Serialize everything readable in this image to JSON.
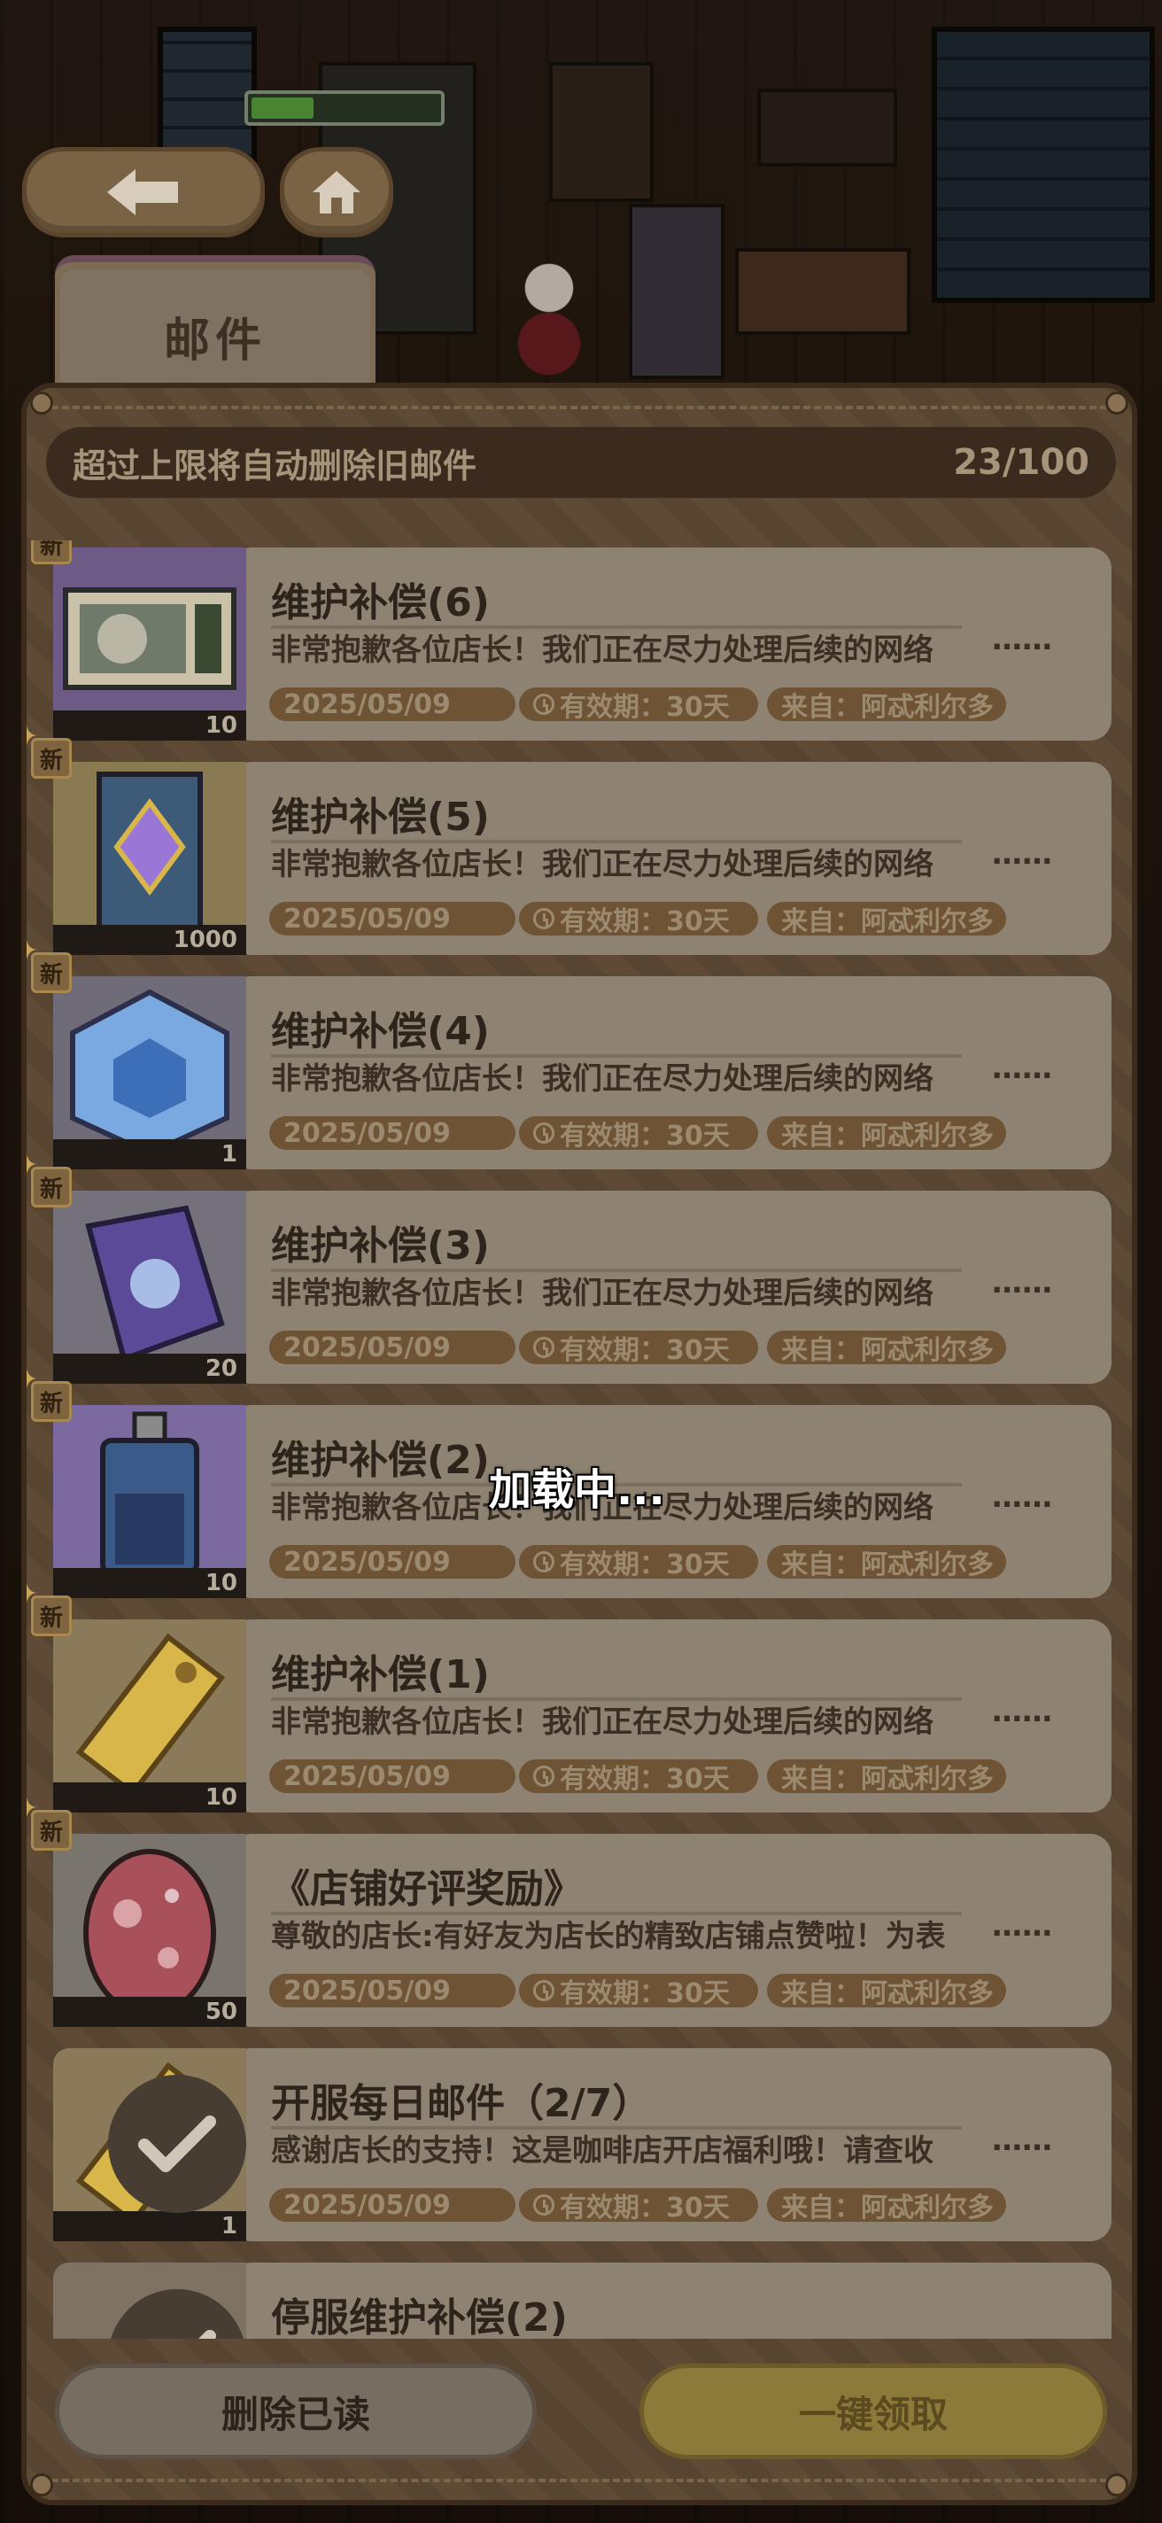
{
  "nav": {
    "back_icon": "arrow-left-icon",
    "home_icon": "home-icon"
  },
  "tab": {
    "label": "邮件"
  },
  "info": {
    "text": "超过上限将自动删除旧邮件",
    "count": "23/100"
  },
  "mail": [
    {
      "title": "维护补偿(6)",
      "body": "非常抱歉各位店长！我们正在尽力处理后续的网络",
      "ellipsis": "……",
      "date": "2025/05/09",
      "validity": "有效期：30天",
      "from": "来自：阿忒利尔多",
      "qty": "10",
      "is_new": true,
      "item_icon": "microwave-icon",
      "read": false
    },
    {
      "title": "维护补偿(5)",
      "body": "非常抱歉各位店长！我们正在尽力处理后续的网络",
      "ellipsis": "……",
      "date": "2025/05/09",
      "validity": "有效期：30天",
      "from": "来自：阿忒利尔多",
      "qty": "1000",
      "is_new": true,
      "item_icon": "purple-gem-card-icon",
      "read": false
    },
    {
      "title": "维护补偿(4)",
      "body": "非常抱歉各位店长！我们正在尽力处理后续的网络",
      "ellipsis": "……",
      "date": "2025/05/09",
      "validity": "有效期：30天",
      "from": "来自：阿忒利尔多",
      "qty": "1",
      "is_new": true,
      "item_icon": "blue-crystal-icon",
      "read": false
    },
    {
      "title": "维护补偿(3)",
      "body": "非常抱歉各位店长！我们正在尽力处理后续的网络",
      "ellipsis": "……",
      "date": "2025/05/09",
      "validity": "有效期：30天",
      "from": "来自：阿忒利尔多",
      "qty": "20",
      "is_new": true,
      "item_icon": "spell-book-icon",
      "read": false
    },
    {
      "title": "维护补偿(2)",
      "body": "非常抱歉各位店长！我们正在尽力处理后续的网络",
      "ellipsis": "……",
      "date": "2025/05/09",
      "validity": "有效期：30天",
      "from": "来自：阿忒利尔多",
      "qty": "10",
      "is_new": true,
      "item_icon": "potion-bottle-icon",
      "read": false
    },
    {
      "title": "维护补偿(1)",
      "body": "非常抱歉各位店长！我们正在尽力处理后续的网络",
      "ellipsis": "……",
      "date": "2025/05/09",
      "validity": "有效期：30天",
      "from": "来自：阿忒利尔多",
      "qty": "10",
      "is_new": true,
      "item_icon": "gold-ticket-icon",
      "read": false
    },
    {
      "title": "《店铺好评奖励》",
      "body": "尊敬的店长:有好友为店长的精致店铺点赞啦！为表",
      "ellipsis": "……",
      "date": "2025/05/09",
      "validity": "有效期：30天",
      "from": "来自：阿忒利尔多",
      "qty": "50",
      "is_new": true,
      "item_icon": "red-egg-icon",
      "read": false
    },
    {
      "title": "开服每日邮件（2/7）",
      "body": "感谢店长的支持！这是咖啡店开店福利哦！请查收",
      "ellipsis": "……",
      "date": "2025/05/09",
      "validity": "有效期：30天",
      "from": "来自：阿忒利尔多",
      "qty": "1",
      "is_new": false,
      "item_icon": "gold-ticket-icon",
      "read": true
    },
    {
      "title": "停服维护补偿(2)",
      "body": "",
      "ellipsis": "",
      "date": "",
      "validity": "",
      "from": "",
      "qty": "",
      "is_new": false,
      "item_icon": "",
      "read": true
    }
  ],
  "new_badge": "新",
  "buttons": {
    "delete_read": "删除已读",
    "claim_all": "一键领取"
  },
  "loading": "加载中...",
  "colors": {
    "panel": "#5e4a35",
    "card": "#8e8272",
    "pill": "#6e5334",
    "claim": "#8c7a3b"
  }
}
